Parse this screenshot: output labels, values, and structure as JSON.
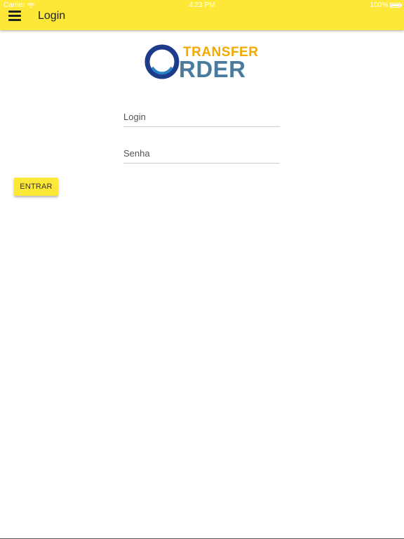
{
  "status_bar": {
    "carrier": "Carrier",
    "time": "4:23 PM",
    "battery": "100%"
  },
  "header": {
    "title": "Login"
  },
  "logo": {
    "line1": "TRANSFER",
    "line2": "RDER",
    "colors": {
      "transfer": "#f2a900",
      "order": "#4a7a9c",
      "ring_outer": "#1e3a8a",
      "ring_inner": "#2b7fc4"
    }
  },
  "form": {
    "login_placeholder": "Login",
    "password_placeholder": "Senha",
    "submit_label": "ENTRAR"
  },
  "colors": {
    "accent": "#fde837"
  }
}
